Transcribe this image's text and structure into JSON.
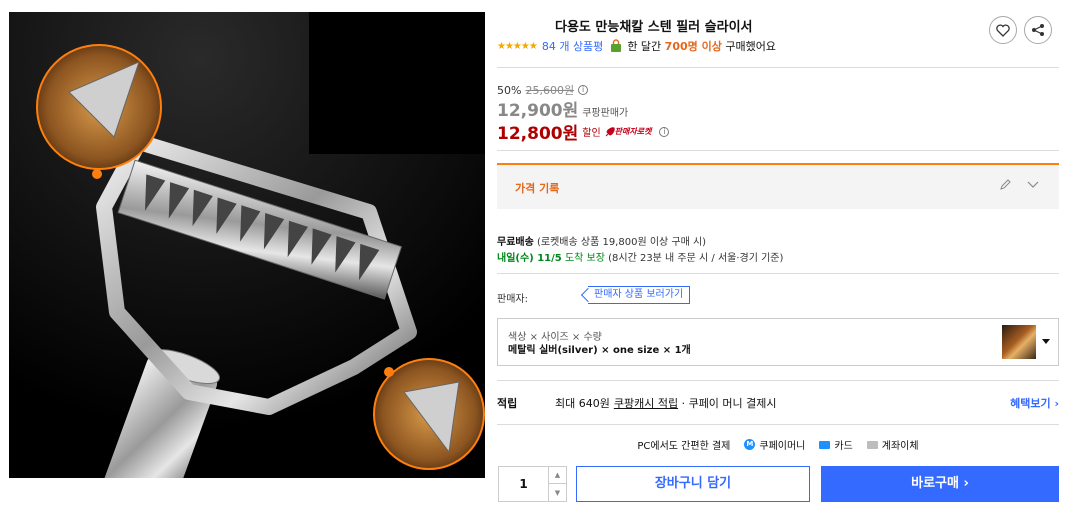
{
  "product": {
    "title": "다용도 만능채칼 스텐 필러 슬라이서",
    "stars": "★★★★★",
    "review_count": "84 개 상품평",
    "purchase_prefix": "한 달간",
    "purchase_count": "700명 이상",
    "purchase_suffix": "구매했어요"
  },
  "price": {
    "discount_rate": "50%",
    "original": "25,600원",
    "info": "ⓘ",
    "coupang_price": "12,900원",
    "coupang_label": "쿠팡판매가",
    "sale_price": "12,800원",
    "sale_label": "할인",
    "rocket_label": "판매자로켓",
    "info2": "ⓘ"
  },
  "history": {
    "label": "가격 기록"
  },
  "shipping": {
    "free_label": "무료배송",
    "free_detail": "(로켓배송 상품 19,800원 이상 구매 시)",
    "arrival_date": "내일(수) 11/5",
    "arrival_guarantee": "도착 보장",
    "arrival_detail": "(8시간 23분 내 주문 시 / 서울⋅경기 기준)"
  },
  "seller": {
    "label": "판매자:",
    "link": "판매자 상품 보러가기"
  },
  "option": {
    "header": "색상 × 사이즈 × 수량",
    "value": "메탈릭 실버(silver) × one size × 1개"
  },
  "cash": {
    "label": "적립",
    "text": "최대 640원",
    "link": "쿠팡캐시 적립",
    "suffix": "· 쿠페이 머니 결제시",
    "more": "혜택보기 ›"
  },
  "payment": {
    "prefix": "PC에서도 간편한 결제",
    "m_letter": "M",
    "money": "쿠페이머니",
    "card": "카드",
    "bank": "계좌이체"
  },
  "purchase": {
    "quantity": "1",
    "up": "▲",
    "down": "▼",
    "cart_button": "장바구니 담기",
    "buy_button": "바로구매 ›"
  },
  "colors": {
    "accent_blue": "#346aff",
    "sale_red": "#ae0000",
    "orange": "#e5681a",
    "green": "#00891a"
  }
}
